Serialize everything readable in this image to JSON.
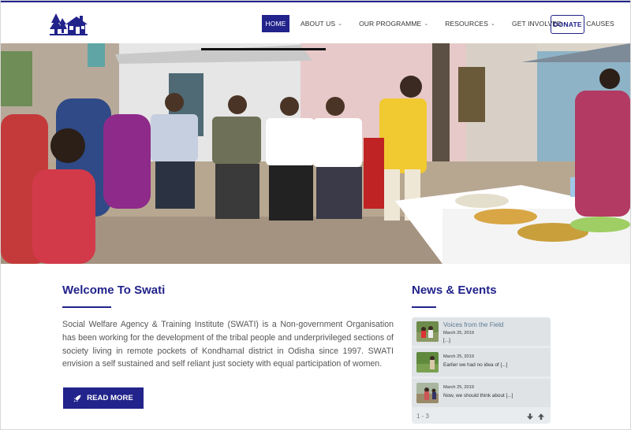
{
  "nav": {
    "items": [
      {
        "label": "HOME",
        "dropdown": false
      },
      {
        "label": "ABOUT US",
        "dropdown": true
      },
      {
        "label": "OUR PROGRAMME",
        "dropdown": true
      },
      {
        "label": "RESOURCES",
        "dropdown": true
      },
      {
        "label": "GET INVOLVED",
        "dropdown": true
      },
      {
        "label": "CAUSES",
        "dropdown": false
      }
    ],
    "active": "HOME",
    "donate_label": "DONATE"
  },
  "welcome": {
    "title": "Welcome To Swati",
    "body": "Social Welfare Agency & Training Institute (SWATI) is a Non-government Organisation has been working for the development of the tribal people and underprivileged sections of society living in remote pockets of Kondhamal district in Odisha since 1997. SWATI envision a self sustained and self reliant just society with equal participation of women.",
    "button_label": "READ MORE"
  },
  "news": {
    "title": "News & Events",
    "items": [
      {
        "title": "Voices from the Field",
        "date": "March 25, 2019",
        "excerpt": "[...]"
      },
      {
        "title": "",
        "date": "March 25, 2019",
        "excerpt": "Earlier we had no idea of [...]"
      },
      {
        "title": "",
        "date": "March 25, 2019",
        "excerpt": "Now, we should think about [...]"
      }
    ],
    "range": "1 - 3"
  },
  "colors": {
    "brand": "#22238b",
    "text": "#555555",
    "news_link": "#5a7a95"
  },
  "icons": {
    "logo": "house-trees-logo",
    "read_more": "rocket-icon",
    "nav_dropdown": "chevron-down-icon",
    "news_next": "arrow-down-icon",
    "news_prev": "arrow-up-icon"
  }
}
